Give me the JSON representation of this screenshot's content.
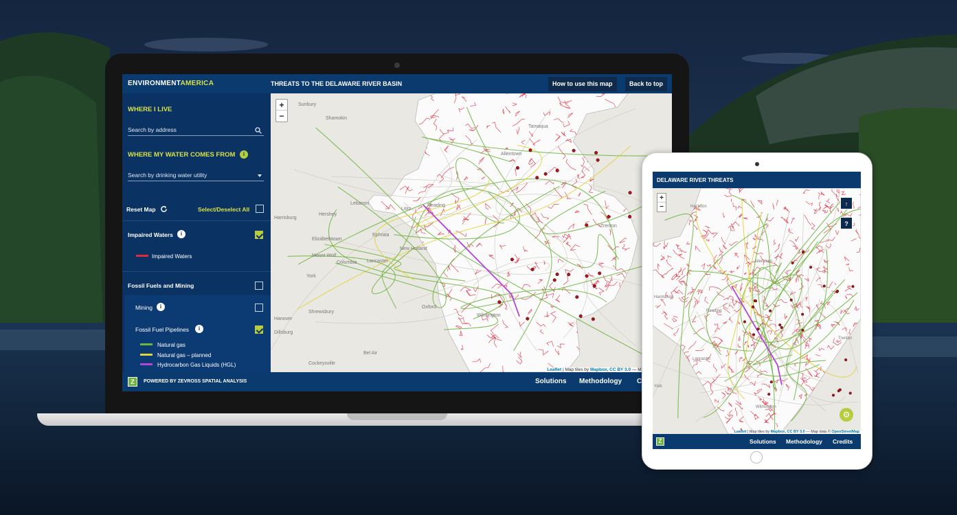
{
  "colors": {
    "navy": "#0b3a6e",
    "sidebar": "#0a3263",
    "accent_yellow": "#d7e04a",
    "checkbox_green": "#b7cc3f",
    "impaired_red": "#e0283c",
    "natural_gas": "#6fb43f",
    "natural_gas_planned": "#e2d23a",
    "hgl": "#b444d8",
    "site_dot": "#a3161d"
  },
  "laptop": {
    "logo_part1": "ENVIRONMENT",
    "logo_part2": "AMERICA",
    "title": "THREATS TO THE DELAWARE RIVER BASIN",
    "how_to_btn": "How to use this map",
    "back_top_btn": "Back to top",
    "sidebar": {
      "where_i_live": "WHERE I LIVE",
      "address_placeholder": "Search by address",
      "water_heading": "WHERE MY WATER COMES FROM",
      "utility_placeholder": "Search by drinking water utility",
      "reset_label": "Reset Map",
      "select_all_label": "Select/Deselect All",
      "impaired_label": "Impaired Waters",
      "impaired_legend": "Impaired Waters",
      "fossil_label": "Fossil Fuels and Mining",
      "mining_label": "Mining",
      "pipelines_label": "Fossil Fuel Pipelines",
      "legend_gas": "Natural gas",
      "legend_gas_planned": "Natural gas – planned",
      "legend_hgl": "Hydrocarbon Gas Liquids (HGL)"
    },
    "map_labels": [
      {
        "text": "Sunbury"
      },
      {
        "text": "Shamokin"
      },
      {
        "text": "Harrisburg"
      },
      {
        "text": "Lebanon"
      },
      {
        "text": "Lancaster"
      },
      {
        "text": "York"
      },
      {
        "text": "Reading"
      },
      {
        "text": "Allentown"
      },
      {
        "text": "Wilmington"
      },
      {
        "text": "Bel Air"
      },
      {
        "text": "Hershey"
      },
      {
        "text": "Elizabethtown"
      },
      {
        "text": "Columbia"
      },
      {
        "text": "Oxford"
      },
      {
        "text": "Shrewsbury"
      },
      {
        "text": "Cockeysville"
      },
      {
        "text": "Ephrata"
      },
      {
        "text": "New Holland"
      },
      {
        "text": "Mount Wolf"
      },
      {
        "text": "Dillsburg"
      },
      {
        "text": "Hanover"
      },
      {
        "text": "Lititz"
      },
      {
        "text": "Tamaqua"
      },
      {
        "text": "Trenton"
      }
    ],
    "attribution_leaflet": "Leaflet",
    "attribution_rest1": " | Map tiles by ",
    "attribution_mapbox": "Mapbox, CC BY 3.0",
    "attribution_rest2": " — Map data © Ope",
    "footer_powered": "POWERED BY ZEVROSS SPATIAL ANALYSIS",
    "footer_solutions": "Solutions",
    "footer_methodology": "Methodology",
    "footer_credits": "C"
  },
  "tablet": {
    "title": "DELAWARE RIVER THREATS",
    "map_labels": [
      {
        "text": "Hazleton"
      },
      {
        "text": "Allentown"
      },
      {
        "text": "Reading"
      },
      {
        "text": "Harrisburg"
      },
      {
        "text": "Lancaster"
      },
      {
        "text": "York"
      },
      {
        "text": "Wilmington"
      },
      {
        "text": "Trenton"
      }
    ],
    "attribution_leaflet": "Leaflet",
    "attribution_rest1": " | Map tiles by ",
    "attribution_mapbox": "Mapbox, CC BY 3.0",
    "attribution_rest2": " — Map data © ",
    "attribution_osm": "OpenStreetMap",
    "footer_solutions": "Solutions",
    "footer_methodology": "Methodology",
    "footer_credits": "Credits"
  },
  "zoom": {
    "plus": "+",
    "minus": "−"
  }
}
